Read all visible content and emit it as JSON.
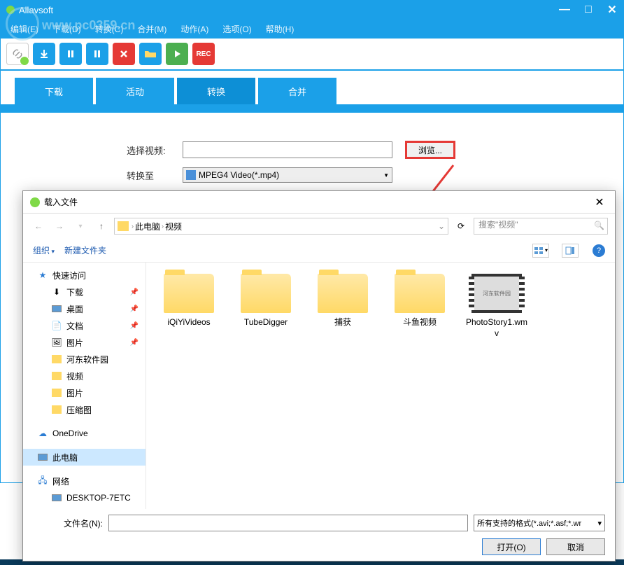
{
  "app": {
    "title": "Allavsoft",
    "watermark": "www.pc0359.cn"
  },
  "menubar": {
    "items": [
      "编辑(E)",
      "下载(D)",
      "转换(C)",
      "合并(M)",
      "动作(A)",
      "选项(O)",
      "帮助(H)"
    ]
  },
  "toolbar": {
    "rec_label": "REC"
  },
  "tabs": {
    "items": [
      "下载",
      "活动",
      "转换",
      "合并"
    ],
    "active_index": 2
  },
  "form": {
    "select_video_label": "选择视频:",
    "convert_to_label": "转换至",
    "browse_label": "浏览...",
    "format_value": "MPEG4 Video(*.mp4)"
  },
  "dialog": {
    "title": "载入文件",
    "breadcrumb": {
      "items": [
        "此电脑",
        "视频"
      ]
    },
    "search_placeholder": "搜索\"视频\"",
    "toolbar": {
      "organize": "组织",
      "new_folder": "新建文件夹"
    },
    "sidebar": {
      "quick_access": "快速访问",
      "downloads": "下载",
      "desktop": "桌面",
      "documents": "文档",
      "pictures": "图片",
      "hedong": "河东软件园",
      "videos": "视频",
      "pictures2": "图片",
      "compressed": "压缩图",
      "onedrive": "OneDrive",
      "this_pc": "此电脑",
      "network": "网络",
      "desktop_device": "DESKTOP-7ETC"
    },
    "files": [
      {
        "name": "iQiYiVideos",
        "type": "folder"
      },
      {
        "name": "TubeDigger",
        "type": "folder"
      },
      {
        "name": "捕获",
        "type": "folder"
      },
      {
        "name": "斗鱼视频",
        "type": "folder"
      },
      {
        "name": "PhotoStory1.wmv",
        "type": "video"
      }
    ],
    "footer": {
      "filename_label": "文件名(N):",
      "filter_text": "所有支持的格式(*.avi;*.asf;*.wr",
      "open_label": "打开(O)",
      "cancel_label": "取消"
    }
  }
}
